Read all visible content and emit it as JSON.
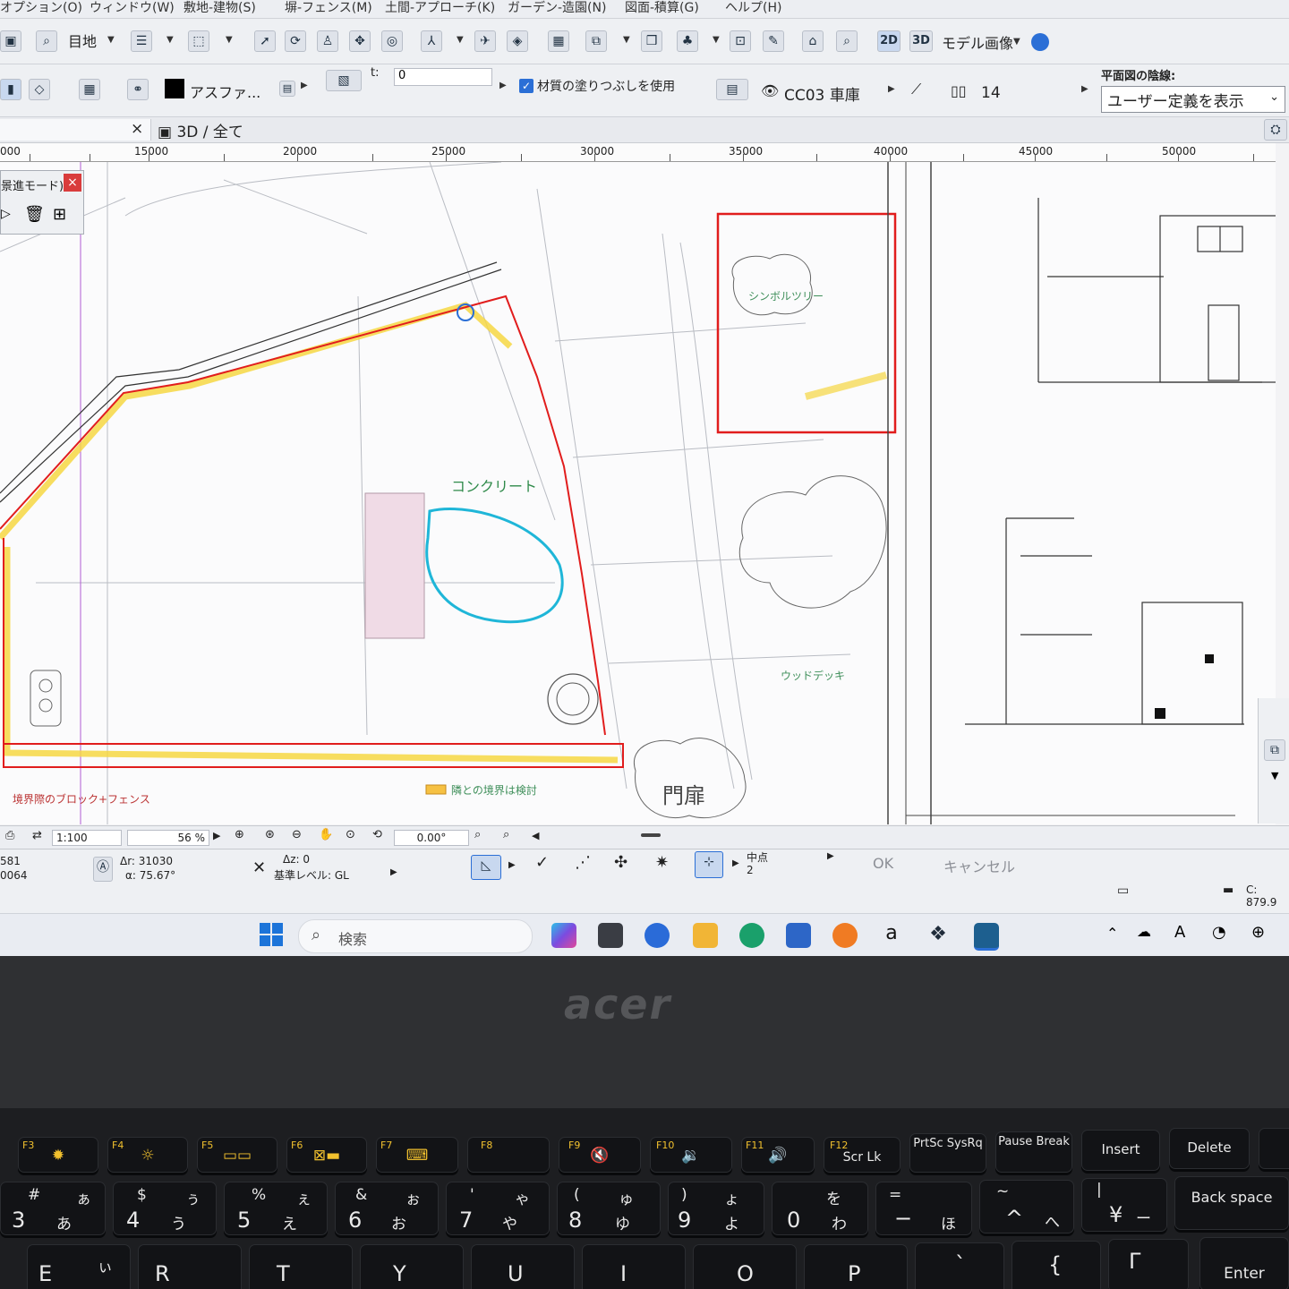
{
  "menu": [
    "オプション(O)",
    "ウィンドウ(W)",
    "敷地-建物(S)",
    "塀-フェンス(M)",
    "土間-アプローチ(K)",
    "ガーデン-造園(N)",
    "図面-積算(G)",
    "ヘルプ(H)"
  ],
  "toolbar1": {
    "layer_label": "目地",
    "btn_2d": "2D",
    "btn_3d": "3D",
    "model_image": "モデル画像"
  },
  "toolbar2": {
    "material": "アスファ...",
    "t_label": "t:",
    "t_value": "0",
    "fill_checkbox": "材質の塗りつぶしを使用",
    "layer_code": "CC03 車庫",
    "pen_value": "14",
    "hidden_line_label": "平面図の陰線:",
    "hidden_line_value": "ユーザー定義を表示"
  },
  "tabs": {
    "tab_close": "×",
    "tab_3d": "3D / 全て"
  },
  "ruler": [
    "000",
    "15000",
    "20000",
    "25000",
    "30000",
    "35000",
    "40000",
    "45000",
    "50000"
  ],
  "palette": {
    "title": "景進モード)",
    "close": "×"
  },
  "sketch_notes": {
    "concrete": "コンクリート",
    "gate": "門扉",
    "tree": "シンボルツリー",
    "wood_deck": "ウッドデッキ",
    "boundary_note": "隣との境界は検討",
    "block_note": "境界際のブロック+フェンス"
  },
  "status": {
    "scale": "1:100",
    "zoom": "56 %",
    "angle": "0.00°"
  },
  "info": {
    "coord1": "581",
    "coord2": "0064",
    "dr_value": "Δr: 31030",
    "alpha_value": "α: 75.67°",
    "dz_value": "Δz: 0",
    "level": "基準レベル: GL",
    "snap_label": "中点",
    "snap_count": "2",
    "ok": "OK",
    "cancel": "キャンセル",
    "disk": "C: 879.9"
  },
  "taskbar": {
    "search": "検索"
  },
  "laptop": {
    "brand": "acer"
  },
  "keys": {
    "f3": "F3",
    "f4": "F4",
    "f5": "F5",
    "f6": "F6",
    "f7": "F7",
    "f8": "F8",
    "f9": "F9",
    "f10": "F10",
    "f11": "F11",
    "f12": "F12",
    "scrlk": "Scr Lk",
    "prtsc": "PrtSc SysRq",
    "pause": "Pause Break",
    "insert": "Insert",
    "delete": "Delete",
    "n3": "3",
    "n4": "4",
    "n5": "5",
    "n6": "6",
    "n7": "7",
    "n8": "8",
    "n9": "9",
    "n0": "0",
    "backspace": "Back space",
    "e": "E",
    "r": "R",
    "t": "T",
    "y": "Y",
    "u": "U",
    "i": "I",
    "o": "O",
    "p": "P",
    "enter": "Enter"
  },
  "colors": {
    "accent": "#2b6fd6",
    "outline": "#e11d1d",
    "highlight": "#f6d743",
    "sketch_blue": "#1fb6d8",
    "key_legend": "#f2c12e"
  }
}
